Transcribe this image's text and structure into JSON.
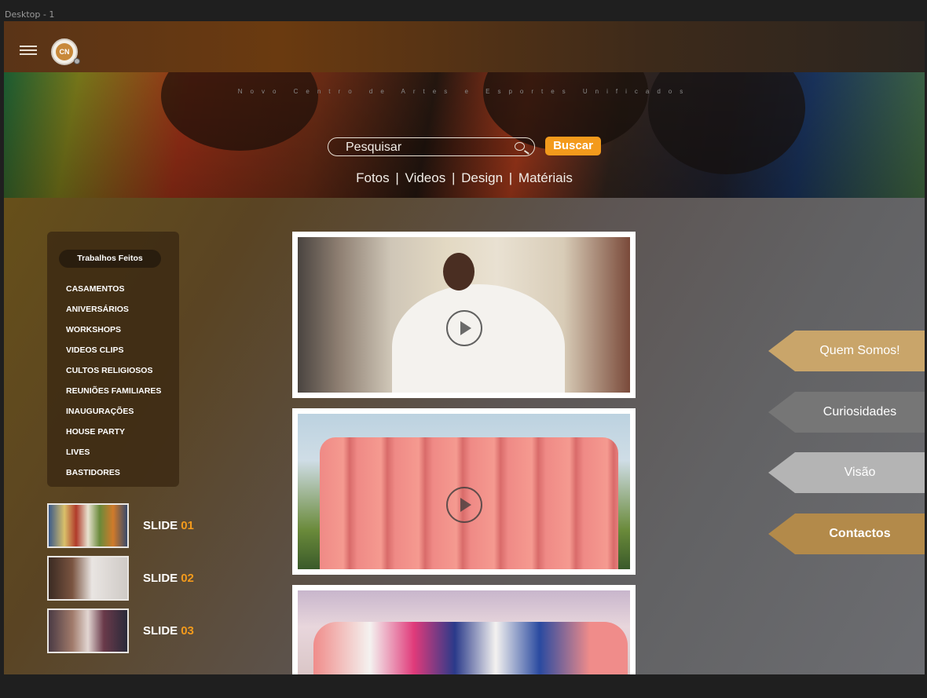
{
  "frame": {
    "label": "Desktop - 1"
  },
  "header": {
    "logo_text": "CN",
    "tagline": "Novo Centro de Artes e Esportes Unificados"
  },
  "search": {
    "placeholder": "Pesquisar",
    "button_label": "Buscar"
  },
  "categories": [
    {
      "label": "Fotos"
    },
    {
      "label": "Videos"
    },
    {
      "label": "Design"
    },
    {
      "label": "Matériais"
    }
  ],
  "category_separator": "|",
  "sidebar": {
    "title": "Trabalhos Feitos",
    "items": [
      "CASAMENTOS",
      "ANIVERSÁRIOS",
      "WORKSHOPS",
      "VIDEOS CLIPS",
      "CULTOS RELIGIOSOS",
      "REUNIÕES FAMILIARES",
      "INAUGURAÇÕES",
      "HOUSE PARTY",
      "LIVES",
      "BASTIDORES"
    ]
  },
  "slides": [
    {
      "label": "SLIDE",
      "number": "01"
    },
    {
      "label": "SLIDE",
      "number": "02"
    },
    {
      "label": "SLIDE",
      "number": "03"
    }
  ],
  "side_tabs": [
    {
      "label": "Quem Somos!",
      "color": "#c9a56a"
    },
    {
      "label": "Curiosidades",
      "color": "#767676"
    },
    {
      "label": "Visão",
      "color": "#b4b4b4"
    },
    {
      "label": "Contactos",
      "color": "#b38a4a"
    }
  ],
  "colors": {
    "accent": "#f39a1c"
  }
}
